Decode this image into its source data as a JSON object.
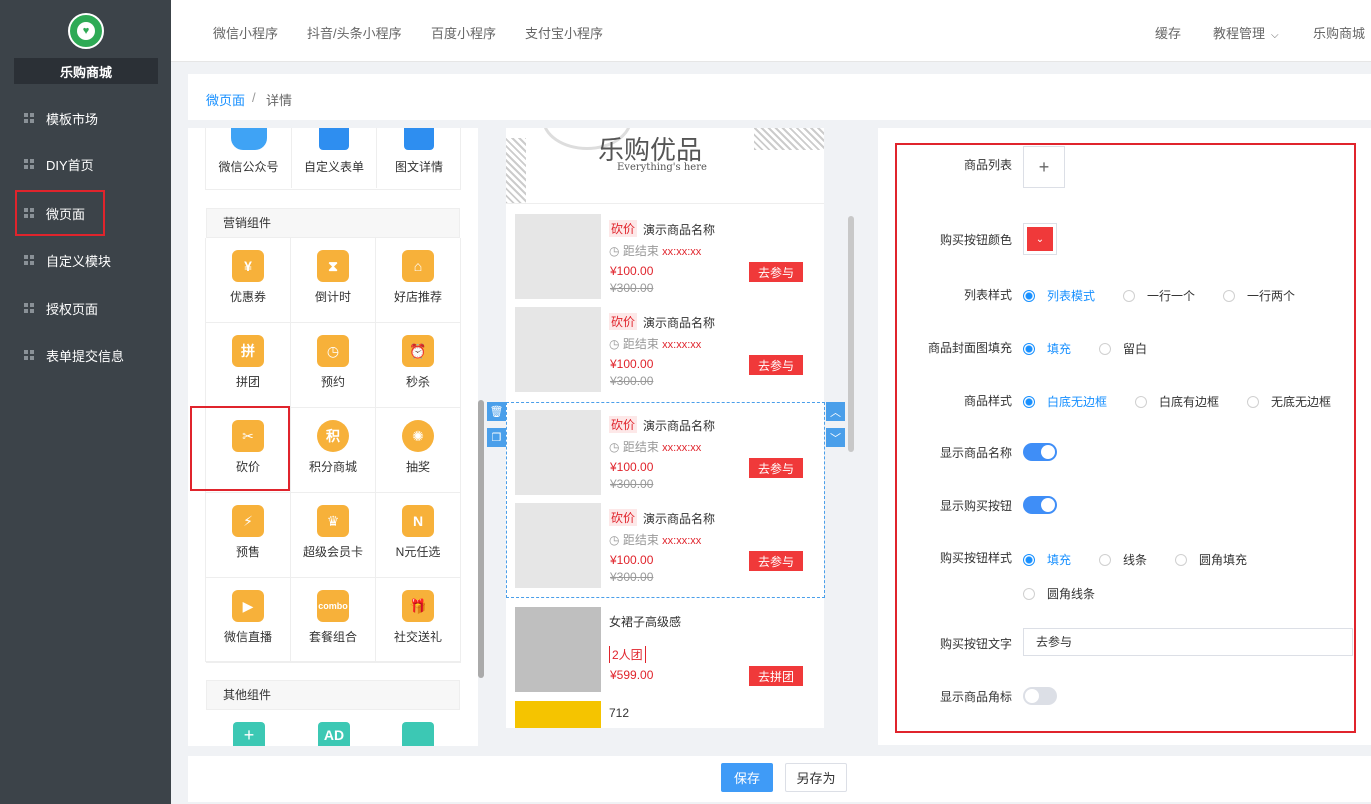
{
  "sidebar": {
    "shop_name": "乐购商城",
    "items": [
      {
        "label": "模板市场"
      },
      {
        "label": "DIY首页"
      },
      {
        "label": "微页面"
      },
      {
        "label": "自定义模块"
      },
      {
        "label": "授权页面"
      },
      {
        "label": "表单提交信息"
      }
    ]
  },
  "topbar": {
    "tabs": [
      "微信小程序",
      "抖音/头条小程序",
      "百度小程序",
      "支付宝小程序"
    ],
    "cache": "缓存",
    "tutorial": "教程管理",
    "shop": "乐购商城"
  },
  "breadcrumb": {
    "link": "微页面",
    "sep": "/",
    "current": "详情"
  },
  "components": {
    "top_row": [
      "微信公众号",
      "自定义表单",
      "图文详情"
    ],
    "marketing_title": "营销组件",
    "marketing": [
      "优惠券",
      "倒计时",
      "好店推荐",
      "拼团",
      "预约",
      "秒杀",
      "砍价",
      "积分商城",
      "抽奖",
      "预售",
      "超级会员卡",
      "N元任选",
      "微信直播",
      "套餐组合",
      "社交送礼"
    ],
    "other_title": "其他组件",
    "icon_glyphs": {
      "coupon": "¥",
      "group": "拼",
      "points": "积",
      "nchoose": "N",
      "ad": "AD",
      "combo": "combo"
    }
  },
  "preview": {
    "banner_title": "乐购优品",
    "banner_sub": "Everything's here",
    "products": [
      {
        "badge": "砍价",
        "name": "演示商品名称",
        "time_label": "距结束",
        "time": "xx:xx:xx",
        "price": "¥100.00",
        "old_price": "¥300.00",
        "button": "去参与"
      },
      {
        "badge": "砍价",
        "name": "演示商品名称",
        "time_label": "距结束",
        "time": "xx:xx:xx",
        "price": "¥100.00",
        "old_price": "¥300.00",
        "button": "去参与"
      },
      {
        "badge": "砍价",
        "name": "演示商品名称",
        "time_label": "距结束",
        "time": "xx:xx:xx",
        "price": "¥100.00",
        "old_price": "¥300.00",
        "button": "去参与"
      },
      {
        "badge": "砍价",
        "name": "演示商品名称",
        "time_label": "距结束",
        "time": "xx:xx:xx",
        "price": "¥100.00",
        "old_price": "¥300.00",
        "button": "去参与"
      }
    ],
    "group_item": {
      "name": "女裙子高级感",
      "tag": "2人团",
      "price": "¥599.00",
      "button": "去拼团"
    },
    "last_item": {
      "name": "712"
    }
  },
  "props": {
    "product_list_label": "商品列表",
    "buy_btn_color_label": "购买按钮颜色",
    "buy_btn_color": "#f0393a",
    "list_style_label": "列表样式",
    "list_style_options": [
      "列表模式",
      "一行一个",
      "一行两个"
    ],
    "cover_fill_label": "商品封面图填充",
    "cover_fill_options": [
      "填充",
      "留白"
    ],
    "product_style_label": "商品样式",
    "product_style_options": [
      "白底无边框",
      "白底有边框",
      "无底无边框"
    ],
    "show_name_label": "显示商品名称",
    "show_name": true,
    "show_buy_label": "显示购买按钮",
    "show_buy": true,
    "buy_style_label": "购买按钮样式",
    "buy_style_options": [
      "填充",
      "线条",
      "圆角填充",
      "圆角线条"
    ],
    "buy_text_label": "购买按钮文字",
    "buy_text": "去参与",
    "show_corner_label": "显示商品角标",
    "show_corner": false
  },
  "footer": {
    "save": "保存",
    "save_as": "另存为"
  }
}
